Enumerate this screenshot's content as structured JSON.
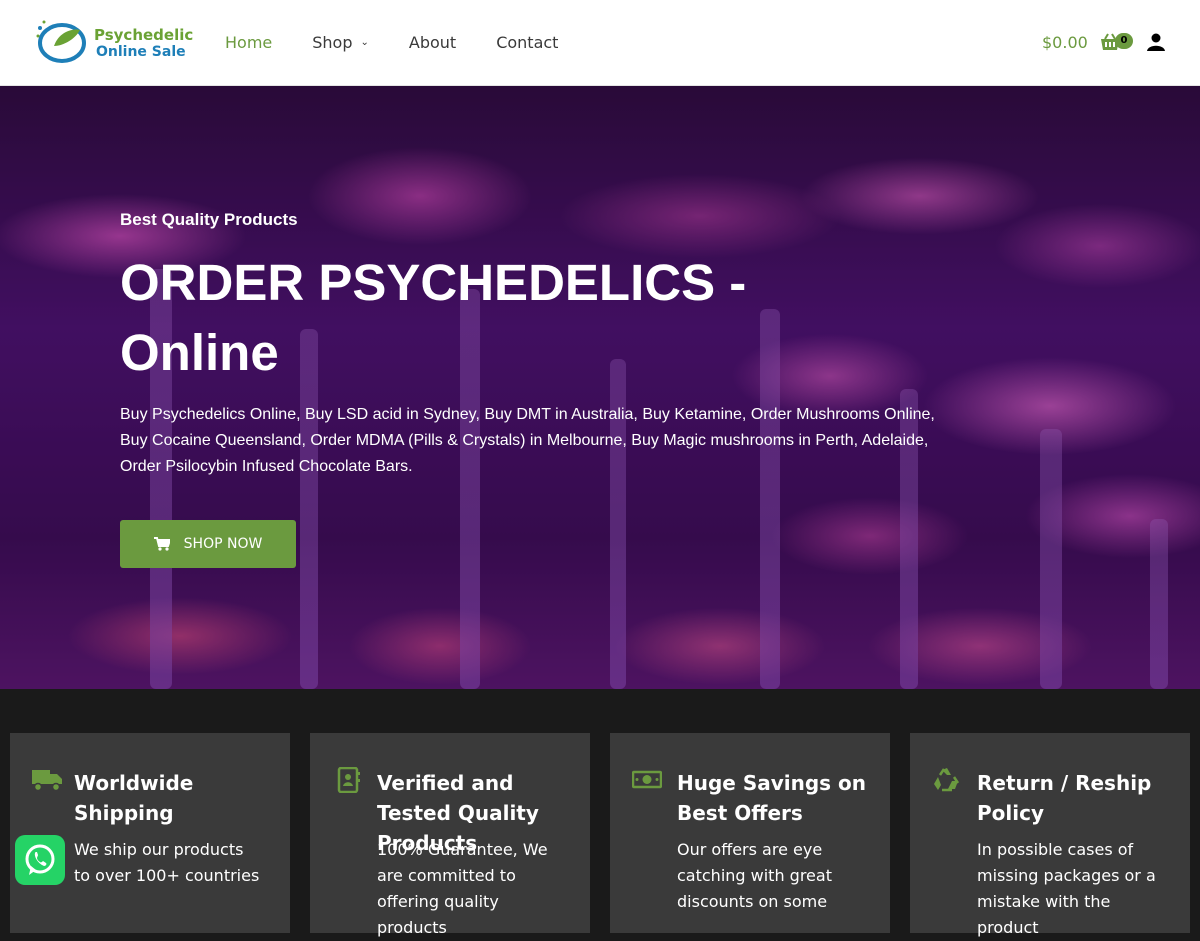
{
  "header": {
    "logo_line1": "Psychedelic",
    "logo_line2": "Online Sale",
    "nav": [
      {
        "label": "Home"
      },
      {
        "label": "Shop"
      },
      {
        "label": "About"
      },
      {
        "label": "Contact"
      }
    ],
    "cart_total": "$0.00",
    "cart_count": "0"
  },
  "hero": {
    "subtitle": "Best Quality Products",
    "title": "ORDER PSYCHEDELICS - Online",
    "description": "Buy Psychedelics Online, Buy LSD acid in Sydney, Buy DMT in Australia, Buy Ketamine, Order Mushrooms Online, Buy Cocaine Queensland, Order MDMA (Pills & Crystals) in Melbourne, Buy Magic mushrooms in Perth, Adelaide, Order Psilocybin Infused Chocolate Bars.",
    "button_label": "SHOP NOW"
  },
  "features": [
    {
      "icon": "truck-icon",
      "title": "Worldwide Shipping",
      "text": "We ship our products to over 100+ countries"
    },
    {
      "icon": "contact-book-icon",
      "title": "Verified and Tested Quality Products",
      "text": "100% Guarantee, We are committed to offering quality products"
    },
    {
      "icon": "money-bill-icon",
      "title": "Huge Savings on Best Offers",
      "text": "Our offers are eye catching with great discounts on some"
    },
    {
      "icon": "recycle-icon",
      "title": "Return / Reship Policy",
      "text": "In possible cases of missing packages or a mistake with the product"
    }
  ],
  "colors": {
    "accent": "#6b9a3f",
    "card_bg": "#3a3a3a",
    "whatsapp": "#25d366"
  }
}
